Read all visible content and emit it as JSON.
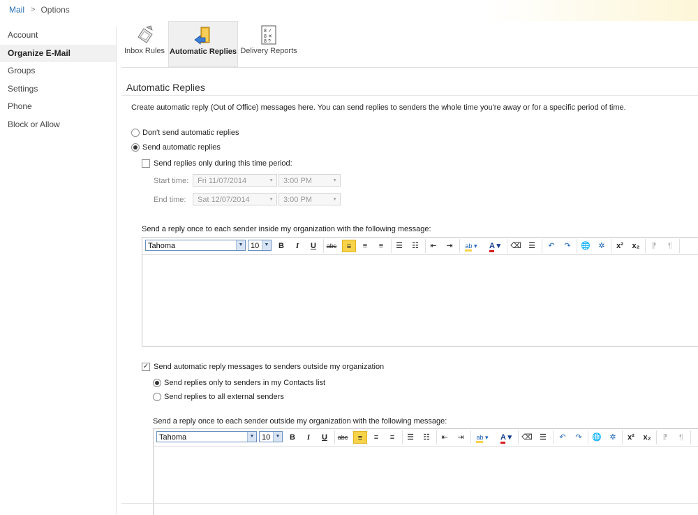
{
  "breadcrumb": {
    "mail": "Mail",
    "separator": ">",
    "options": "Options"
  },
  "sidebar": {
    "items": [
      {
        "label": "Account",
        "active": false
      },
      {
        "label": "Organize E-Mail",
        "active": true
      },
      {
        "label": "Groups",
        "active": false
      },
      {
        "label": "Settings",
        "active": false
      },
      {
        "label": "Phone",
        "active": false
      },
      {
        "label": "Block or Allow",
        "active": false
      }
    ]
  },
  "toolbar": {
    "inbox_rules": "Inbox Rules",
    "automatic_replies": "Automatic Replies",
    "delivery_reports": "Delivery Reports"
  },
  "section": {
    "title": "Automatic Replies",
    "description": "Create automatic reply (Out of Office) messages here. You can send replies to senders the whole time you're away or for a specific period of time."
  },
  "options": {
    "dont_send": "Don't send automatic replies",
    "send": "Send automatic replies",
    "time_period": "Send replies only during this time period:",
    "start_label": "Start time:",
    "start_date": "Fri 11/07/2014",
    "start_time": "3:00 PM",
    "end_label": "End time:",
    "end_date": "Sat 12/07/2014",
    "end_time": "3:00 PM",
    "inside_msg_label": "Send a reply once to each sender inside my organization with the following message:",
    "outside_check": "Send automatic reply messages to senders outside my organization",
    "contacts_only": "Send replies only to senders in my Contacts list",
    "all_external": "Send replies to all external senders",
    "outside_msg_label": "Send a reply once to each sender outside my organization with the following message:"
  },
  "editor": {
    "font": "Tahoma",
    "size": "10"
  },
  "state": {
    "send_selected": true,
    "time_period_checked": false,
    "outside_checked": true,
    "contacts_only_selected": true
  },
  "colors": {
    "accent": "#2b6fb6",
    "highlight": "#f7d34a",
    "font_color_bar": "#d81e1e"
  }
}
